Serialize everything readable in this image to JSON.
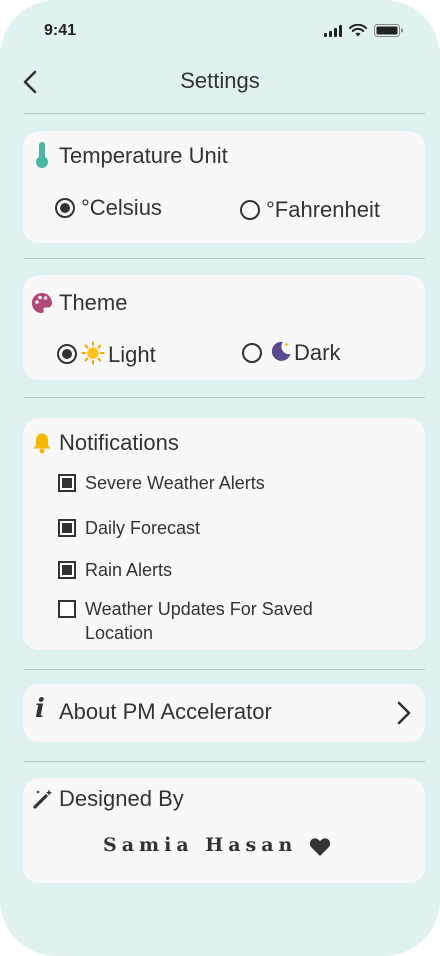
{
  "status": {
    "time": "9:41"
  },
  "header": {
    "title": "Settings"
  },
  "temperature": {
    "title": "Temperature Unit",
    "options": [
      {
        "label": "°Celsius",
        "selected": true
      },
      {
        "label": "°Fahrenheit",
        "selected": false
      }
    ]
  },
  "theme": {
    "title": "Theme",
    "options": [
      {
        "label": "Light",
        "icon": "sun-icon",
        "selected": true
      },
      {
        "label": "Dark",
        "icon": "moon-icon",
        "selected": false
      }
    ]
  },
  "notifications": {
    "title": "Notifications",
    "items": [
      {
        "label": "Severe Weather Alerts",
        "checked": true
      },
      {
        "label": "Daily Forecast",
        "checked": true
      },
      {
        "label": "Rain Alerts",
        "checked": true
      },
      {
        "label": "Weather Updates For Saved Location",
        "checked": false
      }
    ]
  },
  "about": {
    "label": "About PM Accelerator"
  },
  "designed": {
    "title": "Designed By",
    "name": "Samia Hasan"
  },
  "colors": {
    "background": "#dff1f0",
    "card": "#f8f8f8",
    "thermometer": "#4bb7a3",
    "palette": "#b0487a",
    "bell": "#f5b800",
    "heart": "#333333"
  }
}
